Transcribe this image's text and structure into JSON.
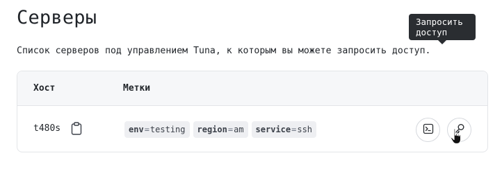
{
  "page": {
    "title": "Серверы",
    "subtitle": "Список серверов под управлением Tuna, к которым вы можете запросить доступ."
  },
  "table": {
    "columns": [
      "Хост",
      "Метки"
    ],
    "rows": [
      {
        "host": "t480s",
        "tags": [
          {
            "key": "env",
            "value": "testing"
          },
          {
            "key": "region",
            "value": "am"
          },
          {
            "key": "service",
            "value": "ssh"
          }
        ],
        "actions": {
          "terminal_icon": "terminal-icon",
          "request_icon": "key-icon"
        }
      }
    ]
  },
  "tooltip": {
    "line1": "Запросить",
    "line2": "доступ"
  },
  "icons": {
    "copy": "clipboard-icon",
    "cursor": "hand-pointer-icon"
  },
  "colors": {
    "header_bg": "#f6f7f9",
    "tag_bg": "#eeeff2",
    "tooltip_bg": "#2a2d31",
    "border": "#e3e5e8"
  }
}
